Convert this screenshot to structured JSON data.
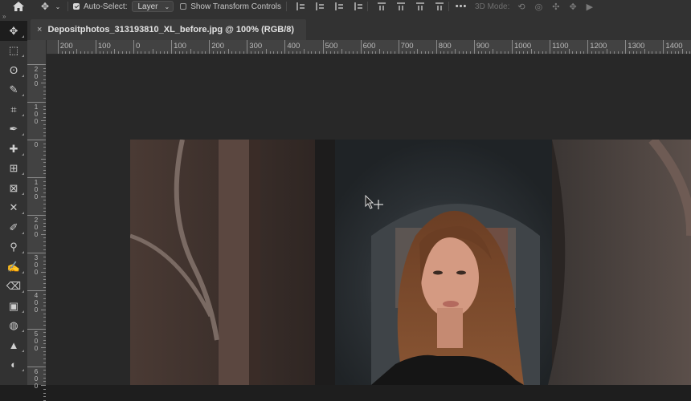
{
  "options_bar": {
    "auto_select_label": "Auto-Select:",
    "auto_select_checked": true,
    "layer_select_value": "Layer",
    "show_transform_label": "Show Transform Controls",
    "show_transform_checked": false,
    "mode_3d_label": "3D Mode:"
  },
  "document": {
    "tab_title": "Depositphotos_313193810_XL_before.jpg @ 100% (RGB/8)",
    "close_glyph": "×"
  },
  "rulers": {
    "horizontal": [
      {
        "label": "200",
        "value": -200
      },
      {
        "label": "100",
        "value": -100
      },
      {
        "label": "0",
        "value": 0
      },
      {
        "label": "100",
        "value": 100
      },
      {
        "label": "200",
        "value": 200
      },
      {
        "label": "300",
        "value": 300
      },
      {
        "label": "400",
        "value": 400
      },
      {
        "label": "500",
        "value": 500
      },
      {
        "label": "600",
        "value": 600
      },
      {
        "label": "700",
        "value": 700
      },
      {
        "label": "800",
        "value": 800
      },
      {
        "label": "900",
        "value": 900
      },
      {
        "label": "1000",
        "value": 1000
      },
      {
        "label": "1100",
        "value": 1100
      },
      {
        "label": "1200",
        "value": 1200
      },
      {
        "label": "1300",
        "value": 1300
      },
      {
        "label": "1400",
        "value": 1400
      }
    ],
    "vertical": [
      {
        "label": "200",
        "value": -200
      },
      {
        "label": "100",
        "value": -100
      },
      {
        "label": "0",
        "value": 0
      },
      {
        "label": "100",
        "value": 100
      },
      {
        "label": "200",
        "value": 200
      },
      {
        "label": "300",
        "value": 300
      },
      {
        "label": "400",
        "value": 400
      },
      {
        "label": "500",
        "value": 500
      },
      {
        "label": "600",
        "value": 600
      }
    ]
  },
  "tools": [
    {
      "name": "move-tool",
      "glyph": "✥",
      "active": true
    },
    {
      "name": "rectangular-marquee-tool",
      "glyph": "⬚",
      "active": false
    },
    {
      "name": "lasso-tool",
      "glyph": "ʘ",
      "active": false
    },
    {
      "name": "quick-selection-tool",
      "glyph": "✎",
      "active": false
    },
    {
      "name": "crop-tool",
      "glyph": "⌗",
      "active": false
    },
    {
      "name": "eyedropper-tool",
      "glyph": "✒",
      "active": false
    },
    {
      "name": "healing-brush-tool",
      "glyph": "✚",
      "active": false
    },
    {
      "name": "patch-tool",
      "glyph": "⊞",
      "active": false
    },
    {
      "name": "frame-tool",
      "glyph": "⊠",
      "active": false
    },
    {
      "name": "content-aware-move-tool",
      "glyph": "✕",
      "active": false
    },
    {
      "name": "brush-tool",
      "glyph": "✐",
      "active": false
    },
    {
      "name": "clone-stamp-tool",
      "glyph": "⚲",
      "active": false
    },
    {
      "name": "history-brush-tool",
      "glyph": "✍",
      "active": false
    },
    {
      "name": "eraser-tool",
      "glyph": "⌫",
      "active": false
    },
    {
      "name": "gradient-tool",
      "glyph": "▣",
      "active": false
    },
    {
      "name": "blur-tool",
      "glyph": "◍",
      "active": false
    },
    {
      "name": "sharpen-tool",
      "glyph": "▲",
      "active": false
    },
    {
      "name": "dodge-tool",
      "glyph": "◐",
      "active": false
    }
  ],
  "colors": {
    "app_bg": "#1e1e1e",
    "panel": "#323232",
    "ruler": "#424242",
    "pasteboard": "#282828"
  }
}
